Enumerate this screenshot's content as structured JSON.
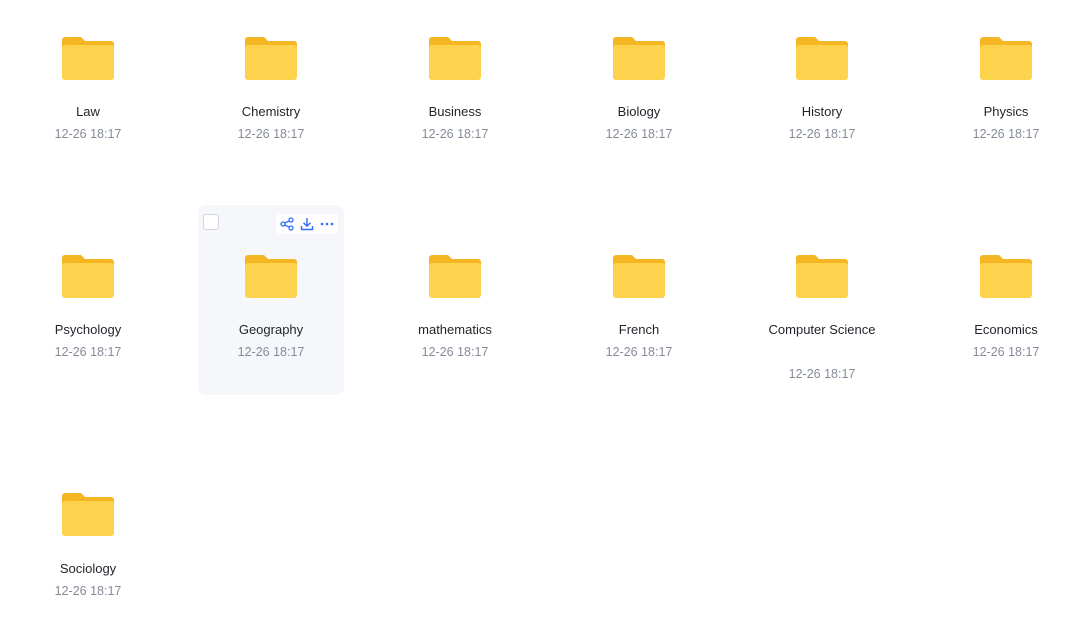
{
  "colors": {
    "folder_back": "#f5b623",
    "folder_front": "#fdd34d",
    "accent": "#2f6bff",
    "name_text": "#1f2329",
    "date_text": "#858b99",
    "hover_bg": "#f5f7fb"
  },
  "folders": [
    {
      "name": "Law",
      "date": "12-26 18:17"
    },
    {
      "name": "Chemistry",
      "date": "12-26 18:17"
    },
    {
      "name": "Business",
      "date": "12-26 18:17"
    },
    {
      "name": "Biology",
      "date": "12-26 18:17"
    },
    {
      "name": "History",
      "date": "12-26 18:17"
    },
    {
      "name": "Physics",
      "date": "12-26 18:17"
    },
    {
      "name": "Psychology",
      "date": "12-26 18:17"
    },
    {
      "name": "Geography",
      "date": "12-26 18:17",
      "hovered": true
    },
    {
      "name": "mathematics",
      "date": "12-26 18:17"
    },
    {
      "name": "French",
      "date": "12-26 18:17"
    },
    {
      "name": "Computer Science",
      "date": "12-26 18:17"
    },
    {
      "name": "Economics",
      "date": "12-26 18:17"
    },
    {
      "name": "Sociology",
      "date": "12-26 18:17"
    }
  ],
  "hover_actions": [
    {
      "icon": "share-icon"
    },
    {
      "icon": "download-icon"
    },
    {
      "icon": "more-icon"
    }
  ]
}
